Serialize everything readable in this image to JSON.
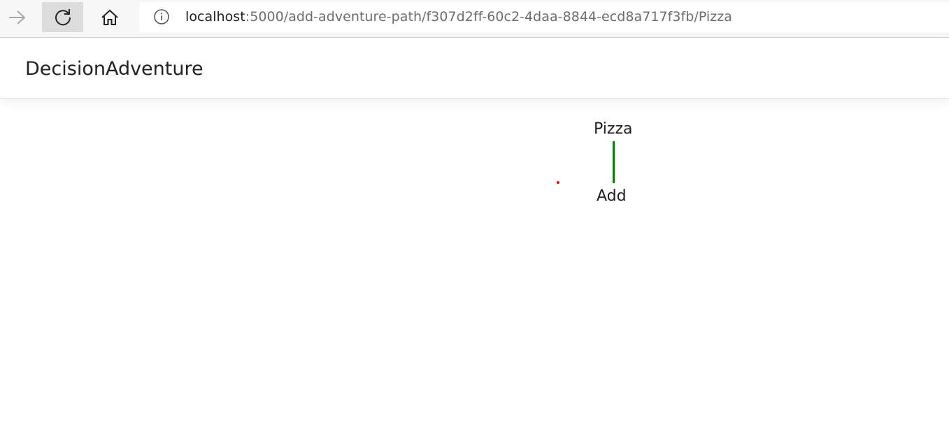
{
  "browser": {
    "url_host": "localhost",
    "url_path": ":5000/add-adventure-path/f307d2ff-60c2-4daa-8844-ecd8a717f3fb/Pizza",
    "icons": [
      "forward-icon",
      "reload-icon",
      "home-icon",
      "info-icon"
    ]
  },
  "app": {
    "brand": "DecisionAdventure"
  },
  "tree": {
    "root_label": "Pizza",
    "add_label": "Add"
  },
  "colors": {
    "path_line": "#0a7a0a",
    "marker_dot": "#e01010",
    "reload_active_bg": "#dcdcdc"
  }
}
